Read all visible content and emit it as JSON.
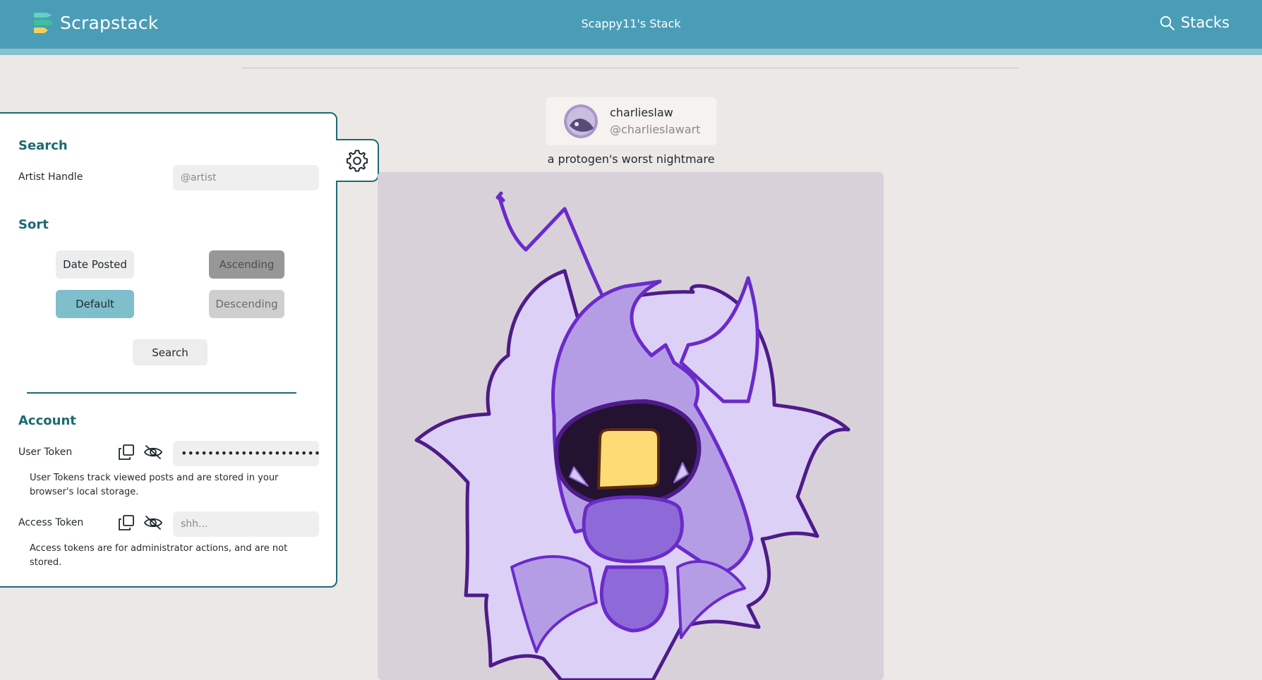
{
  "header": {
    "brand": "Scrapstack",
    "title": "Scappy11's Stack",
    "stacks_label": "Stacks",
    "icons": {
      "logo": "stacked-bars-logo",
      "search": "search-icon"
    }
  },
  "panel": {
    "search": {
      "title": "Search",
      "artist_handle_label": "Artist Handle",
      "artist_handle_placeholder": "@artist",
      "artist_handle_value": ""
    },
    "sort": {
      "title": "Sort",
      "field_options": [
        "Date Posted",
        "Default"
      ],
      "field_selected": "Default",
      "order_options": [
        "Ascending",
        "Descending"
      ],
      "search_button": "Search"
    },
    "account": {
      "title": "Account",
      "user_token_label": "User Token",
      "user_token_value": "••••••••••••••••••••••",
      "user_token_help": "User Tokens track viewed posts and are stored in your browser's local storage.",
      "access_token_label": "Access Token",
      "access_token_placeholder": "shh...",
      "access_token_help": "Access tokens are for administrator actions, and are not stored."
    },
    "gear_icon": "gear-icon"
  },
  "post": {
    "author_name": "charlieslaw",
    "author_handle": "@charlieslawart",
    "caption": "a protogen's worst nightmare"
  },
  "colors": {
    "header": "#4a9db7",
    "accent": "#1d6a72",
    "selected_button": "#7ebfcb",
    "background": "#ece8e5"
  }
}
